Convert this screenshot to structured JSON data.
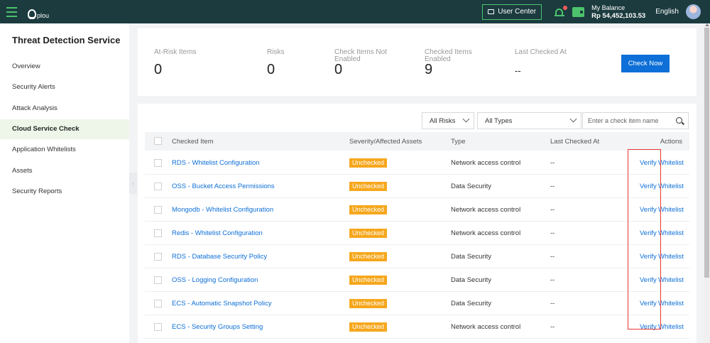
{
  "header": {
    "logo_text": "plou",
    "user_center_label": "User Center",
    "balance_label": "My Balance",
    "balance_value": "Rp 54,452,103.53",
    "language": "English"
  },
  "sidebar": {
    "title": "Threat Detection Service",
    "items": [
      {
        "label": "Overview"
      },
      {
        "label": "Security Alerts"
      },
      {
        "label": "Attack Analysis"
      },
      {
        "label": "Cloud Service Check"
      },
      {
        "label": "Application Whitelists"
      },
      {
        "label": "Assets"
      },
      {
        "label": "Security Reports"
      }
    ],
    "active_index": 3
  },
  "stats": [
    {
      "label": "At-Risk Items",
      "value": "0"
    },
    {
      "label": "Risks",
      "value": "0"
    },
    {
      "label": "Check Items Not Enabled",
      "value": "0"
    },
    {
      "label": "Checked Items Enabled",
      "value": "9"
    },
    {
      "label": "Last Checked At",
      "value": "--"
    }
  ],
  "check_now_label": "Check Now",
  "filters": {
    "risk": "All Risks",
    "type": "All Types",
    "search_placeholder": "Enter a check item name"
  },
  "table": {
    "columns": [
      "Checked Item",
      "Severity/Affected Assets",
      "Type",
      "Last Checked At",
      "Actions"
    ],
    "rows": [
      {
        "item": "RDS - Whitelist Configuration",
        "severity": "Unchecked",
        "type": "Network access control",
        "last": "--",
        "verify": "Verify",
        "whitelist": "Whitelist"
      },
      {
        "item": "OSS - Bucket Access Permissions",
        "severity": "Unchecked",
        "type": "Data Security",
        "last": "--",
        "verify": "Verify",
        "whitelist": "Whitelist"
      },
      {
        "item": "Mongodb - Whitelist Configuration",
        "severity": "Unchecked",
        "type": "Network access control",
        "last": "--",
        "verify": "Verify",
        "whitelist": "Whitelist"
      },
      {
        "item": "Redis - Whitelist Configuration",
        "severity": "Unchecked",
        "type": "Network access control",
        "last": "--",
        "verify": "Verify",
        "whitelist": "Whitelist"
      },
      {
        "item": "RDS - Database Security Policy",
        "severity": "Unchecked",
        "type": "Data Security",
        "last": "--",
        "verify": "Verify",
        "whitelist": "Whitelist"
      },
      {
        "item": "OSS - Logging Configuration",
        "severity": "Unchecked",
        "type": "Data Security",
        "last": "--",
        "verify": "Verify",
        "whitelist": "Whitelist"
      },
      {
        "item": "ECS - Automatic Snapshot Policy",
        "severity": "Unchecked",
        "type": "Data Security",
        "last": "--",
        "verify": "Verify",
        "whitelist": "Whitelist"
      },
      {
        "item": "ECS - Security Groups Setting",
        "severity": "Unchecked",
        "type": "Network access control",
        "last": "--",
        "verify": "Verify",
        "whitelist": "Whitelist"
      }
    ]
  },
  "colors": {
    "topbar": "#1b3b3f",
    "accent_green": "#4cc36b",
    "primary_blue": "#0d6fd7",
    "badge_orange": "#f6a71d",
    "highlight_red": "#e53935"
  }
}
